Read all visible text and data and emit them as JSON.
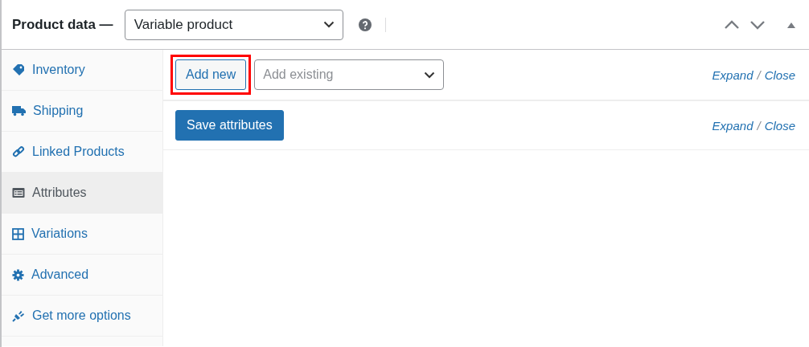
{
  "header": {
    "title": "Product data —",
    "product_type": "Variable product"
  },
  "tabs": [
    {
      "label": "Inventory",
      "selected": false
    },
    {
      "label": "Shipping",
      "selected": false
    },
    {
      "label": "Linked Products",
      "selected": false
    },
    {
      "label": "Attributes",
      "selected": true
    },
    {
      "label": "Variations",
      "selected": false
    },
    {
      "label": "Advanced",
      "selected": false
    },
    {
      "label": "Get more options",
      "selected": false
    }
  ],
  "toolbar": {
    "add_new": {
      "label": "Add new",
      "highlighted": true
    },
    "add_existing": {
      "placeholder": "Add existing"
    },
    "expand": "Expand",
    "separator": "/",
    "close": "Close"
  },
  "footer": {
    "save": "Save attributes",
    "expand": "Expand",
    "separator": "/",
    "close": "Close"
  }
}
